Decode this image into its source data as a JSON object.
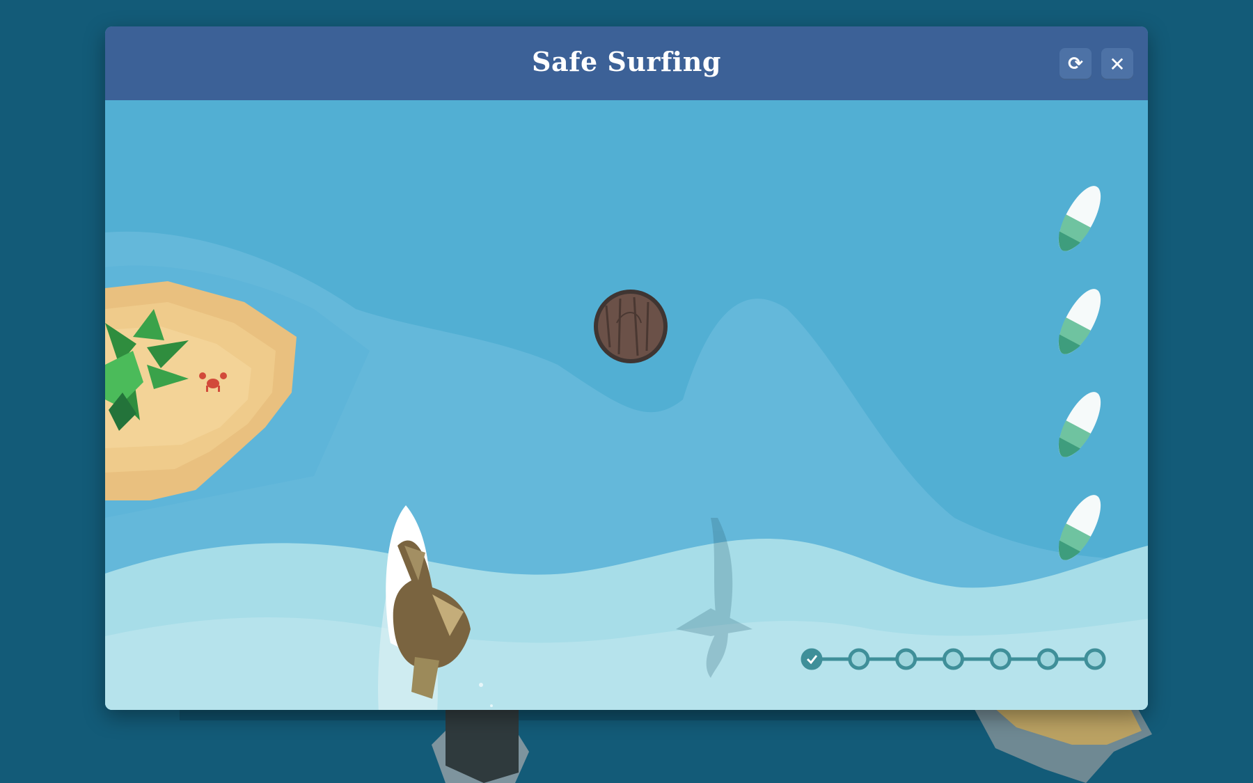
{
  "window": {
    "title": "Safe Surfing"
  },
  "controls": {
    "restart_icon": "restart-icon",
    "restart_glyph": "⟳",
    "close_icon": "close-icon",
    "close_glyph": "✕"
  },
  "game": {
    "lives": 4,
    "progress": {
      "total_steps": 7,
      "completed_steps": 1
    },
    "colors": {
      "page_background": "#135b78",
      "header": "#3c6197",
      "ocean": "#52afd3",
      "wave": "#a7dde8",
      "sand": "#e9c07f"
    }
  }
}
